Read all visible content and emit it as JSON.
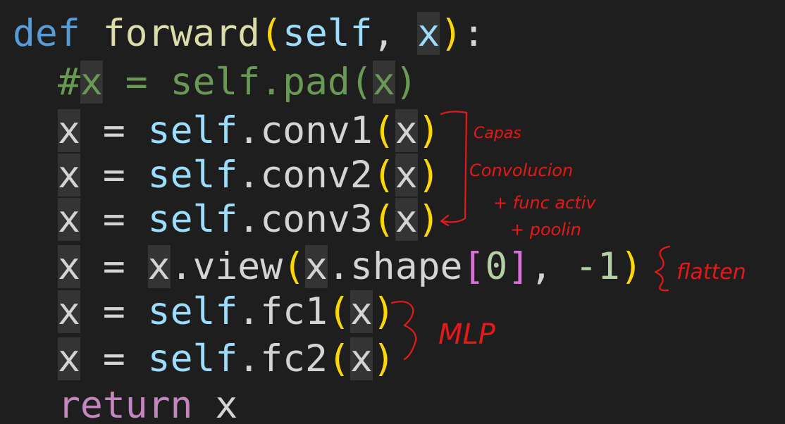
{
  "code": {
    "lines": [
      [
        {
          "t": "def",
          "c": "kw"
        },
        {
          "t": " ",
          "c": "plain"
        },
        {
          "t": "forward",
          "c": "fn"
        },
        {
          "t": "(",
          "c": "brace"
        },
        {
          "t": "self",
          "c": "var"
        },
        {
          "t": ", ",
          "c": "plain"
        },
        {
          "t": "x",
          "c": "var hl"
        },
        {
          "t": ")",
          "c": "brace"
        },
        {
          "t": ":",
          "c": "plain"
        }
      ],
      [
        {
          "t": "#",
          "c": "cmt"
        },
        {
          "t": "x",
          "c": "cmt hl"
        },
        {
          "t": " = self.pad(",
          "c": "cmt"
        },
        {
          "t": "x",
          "c": "cmt hl"
        },
        {
          "t": ")",
          "c": "cmt"
        }
      ],
      [
        {
          "t": "x",
          "c": "plain hl"
        },
        {
          "t": " = ",
          "c": "plain"
        },
        {
          "t": "self",
          "c": "var"
        },
        {
          "t": ".conv1",
          "c": "plain"
        },
        {
          "t": "(",
          "c": "brace"
        },
        {
          "t": "x",
          "c": "plain hl"
        },
        {
          "t": ")",
          "c": "brace"
        }
      ],
      [
        {
          "t": "x",
          "c": "plain hl"
        },
        {
          "t": " = ",
          "c": "plain"
        },
        {
          "t": "self",
          "c": "var"
        },
        {
          "t": ".conv2",
          "c": "plain"
        },
        {
          "t": "(",
          "c": "brace"
        },
        {
          "t": "x",
          "c": "plain hl"
        },
        {
          "t": ")",
          "c": "brace"
        }
      ],
      [
        {
          "t": "x",
          "c": "plain hl"
        },
        {
          "t": " = ",
          "c": "plain"
        },
        {
          "t": "self",
          "c": "var"
        },
        {
          "t": ".conv3",
          "c": "plain"
        },
        {
          "t": "(",
          "c": "brace"
        },
        {
          "t": "x",
          "c": "plain hl"
        },
        {
          "t": ")",
          "c": "brace"
        }
      ],
      [
        {
          "t": "x",
          "c": "plain hl"
        },
        {
          "t": " = ",
          "c": "plain"
        },
        {
          "t": "x",
          "c": "plain hl"
        },
        {
          "t": ".view",
          "c": "plain"
        },
        {
          "t": "(",
          "c": "brace"
        },
        {
          "t": "x",
          "c": "plain hl"
        },
        {
          "t": ".shape",
          "c": "plain"
        },
        {
          "t": "[",
          "c": "brack"
        },
        {
          "t": "0",
          "c": "num"
        },
        {
          "t": "]",
          "c": "brack"
        },
        {
          "t": ", ",
          "c": "plain"
        },
        {
          "t": "-1",
          "c": "num"
        },
        {
          "t": ")",
          "c": "brace"
        }
      ],
      [
        {
          "t": "x",
          "c": "plain hl"
        },
        {
          "t": " = ",
          "c": "plain"
        },
        {
          "t": "self",
          "c": "var"
        },
        {
          "t": ".fc1",
          "c": "plain"
        },
        {
          "t": "(",
          "c": "brace"
        },
        {
          "t": "x",
          "c": "plain hl"
        },
        {
          "t": ")",
          "c": "brace"
        }
      ],
      [
        {
          "t": "x",
          "c": "plain hl"
        },
        {
          "t": " = ",
          "c": "plain"
        },
        {
          "t": "self",
          "c": "var"
        },
        {
          "t": ".fc2",
          "c": "plain"
        },
        {
          "t": "(",
          "c": "brace"
        },
        {
          "t": "x",
          "c": "plain hl"
        },
        {
          "t": ")",
          "c": "brace"
        }
      ],
      [
        {
          "t": "return",
          "c": "ret"
        },
        {
          "t": " x",
          "c": "plain"
        }
      ]
    ]
  },
  "annotations": {
    "conv_block": [
      "Capas",
      "Convolucion",
      "+ func activ",
      "+ poolin"
    ],
    "flatten": "flatten",
    "mlp": "MLP"
  },
  "colors": {
    "background": "#1e1e1e",
    "keyword": "#569cd6",
    "function": "#dcdcaa",
    "variable": "#9cdcfe",
    "text": "#d4d4d4",
    "bracket": "#ffd700",
    "square_bracket": "#da70d6",
    "number": "#b5cea8",
    "return": "#c586c0",
    "comment": "#6a9955",
    "ink": "#e81818"
  }
}
